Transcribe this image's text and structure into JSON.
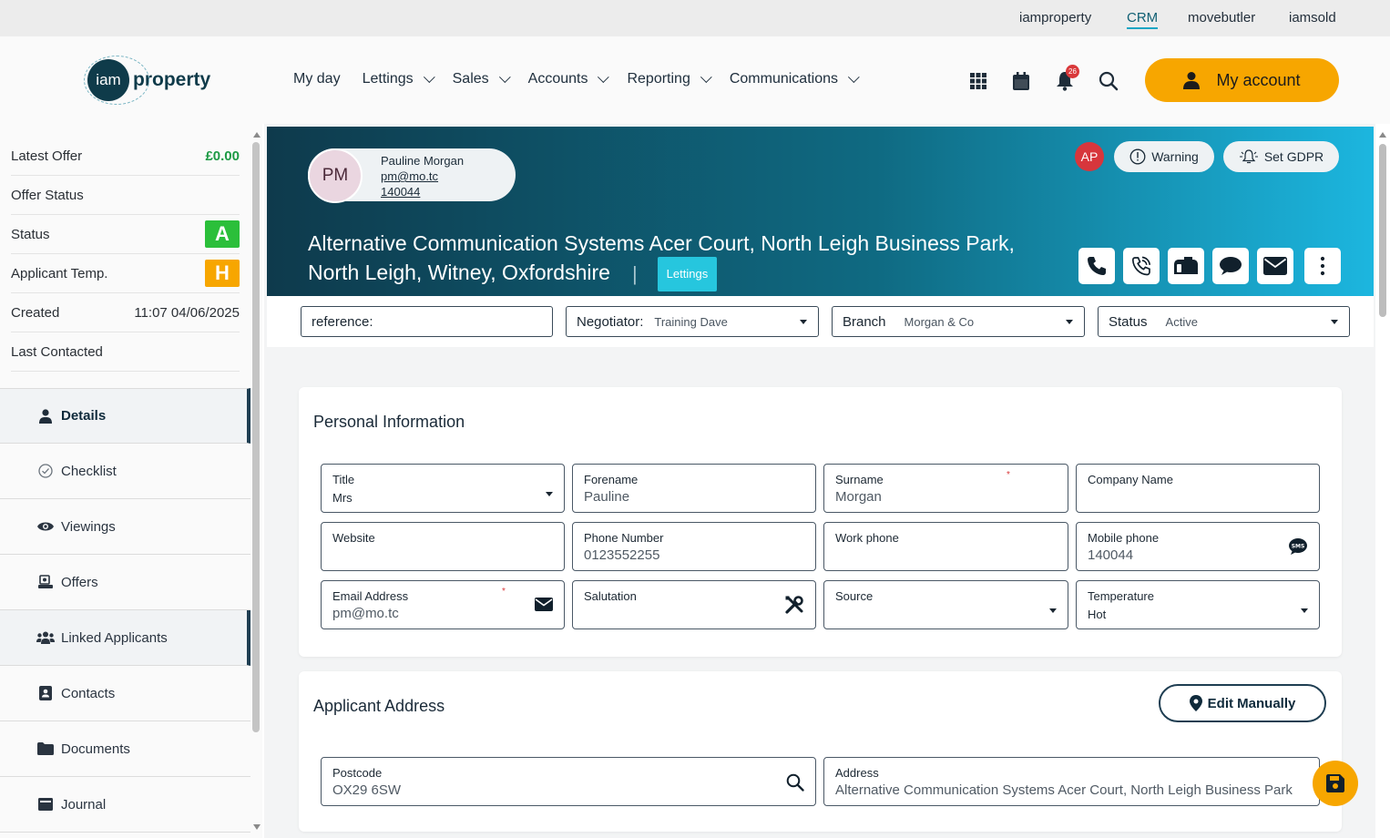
{
  "top_links": [
    {
      "label": "iamproperty",
      "active": false
    },
    {
      "label": "CRM",
      "active": true
    },
    {
      "label": "movebutler",
      "active": false
    },
    {
      "label": "iamsold",
      "active": false
    }
  ],
  "logo": {
    "circle_text": "iam",
    "text": "property"
  },
  "nav": [
    {
      "label": "My day",
      "dropdown": false
    },
    {
      "label": "Lettings",
      "dropdown": true
    },
    {
      "label": "Sales",
      "dropdown": true
    },
    {
      "label": "Accounts",
      "dropdown": true
    },
    {
      "label": "Reporting",
      "dropdown": true
    },
    {
      "label": "Communications",
      "dropdown": true
    }
  ],
  "header_icons": {
    "apps": "grid-icon",
    "calendar": "calendar-icon",
    "notifications": "bell-icon",
    "notification_count": "26",
    "search": "search-icon"
  },
  "account_button": {
    "label": "My account",
    "icon": "user-icon",
    "color": "#f7a600"
  },
  "sidebar": {
    "summary": [
      {
        "label": "Latest Offer",
        "value": "£0.00",
        "style": "green"
      },
      {
        "label": "Offer Status",
        "value": ""
      },
      {
        "label": "Status",
        "value": "A",
        "badge_color": "#2bbf3a"
      },
      {
        "label": "Applicant Temp.",
        "value": "H",
        "badge_color": "#f7a600"
      },
      {
        "label": "Created",
        "value": "11:07 04/06/2025"
      },
      {
        "label": "Last Contacted",
        "value": ""
      }
    ],
    "menu": [
      {
        "label": "Details",
        "icon": "user-icon",
        "active": true
      },
      {
        "label": "Checklist",
        "icon": "check-circle-icon",
        "active": false
      },
      {
        "label": "Viewings",
        "icon": "eye-icon",
        "active": false
      },
      {
        "label": "Offers",
        "icon": "offer-icon",
        "active": false
      },
      {
        "label": "Linked Applicants",
        "icon": "users-icon",
        "active": false
      },
      {
        "label": "Contacts",
        "icon": "contact-card-icon",
        "active": false
      },
      {
        "label": "Documents",
        "icon": "folder-icon",
        "active": false
      },
      {
        "label": "Journal",
        "icon": "journal-icon",
        "active": false
      }
    ]
  },
  "hero": {
    "avatar_initials": "PM",
    "name": "Pauline Morgan",
    "email": "pm@mo.tc",
    "phone": "140044",
    "ap_initials": "AP",
    "warning_label": "Warning",
    "gdpr_label": "Set GDPR",
    "title_line1": "Alternative Communication Systems Acer Court, North Leigh Business Park,",
    "title_line2": "North Leigh, Witney, Oxfordshire",
    "separator": "|",
    "tag": "Lettings",
    "actions": [
      "phone-icon",
      "phone-call-icon",
      "mailbox-icon",
      "chat-icon",
      "envelope-icon",
      "more-vertical-icon"
    ]
  },
  "filters": {
    "reference_label": "reference:",
    "negotiator_label": "Negotiator:",
    "negotiator_value": "Training Dave",
    "branch_label": "Branch",
    "branch_value": "Morgan & Co",
    "status_label": "Status",
    "status_value": "Active"
  },
  "personal": {
    "heading": "Personal Information",
    "fields": {
      "title": {
        "label": "Title",
        "value": "Mrs"
      },
      "forename": {
        "label": "Forename",
        "value": "Pauline"
      },
      "surname": {
        "label": "Surname",
        "value": "Morgan",
        "required": "*"
      },
      "company": {
        "label": "Company Name",
        "value": ""
      },
      "website": {
        "label": "Website",
        "value": ""
      },
      "phone": {
        "label": "Phone Number",
        "value": "0123552255"
      },
      "work_phone": {
        "label": "Work phone",
        "value": ""
      },
      "mobile": {
        "label": "Mobile phone",
        "value": "140044",
        "icon_text": "SMS"
      },
      "email": {
        "label": "Email Address",
        "value": "pm@mo.tc",
        "required": "*"
      },
      "salutation": {
        "label": "Salutation",
        "value": ""
      },
      "source": {
        "label": "Source",
        "value": ""
      },
      "temperature": {
        "label": "Temperature",
        "value": "Hot"
      }
    }
  },
  "address": {
    "heading": "Applicant Address",
    "edit_label": "Edit Manually",
    "postcode_label": "Postcode",
    "postcode_value": "OX29 6SW",
    "address_label": "Address",
    "address_value": "Alternative Communication Systems Acer Court, North Leigh Business Park"
  },
  "colors": {
    "accent": "#f7a600",
    "navy": "#1f3e52",
    "teal": "#1cb6df"
  }
}
